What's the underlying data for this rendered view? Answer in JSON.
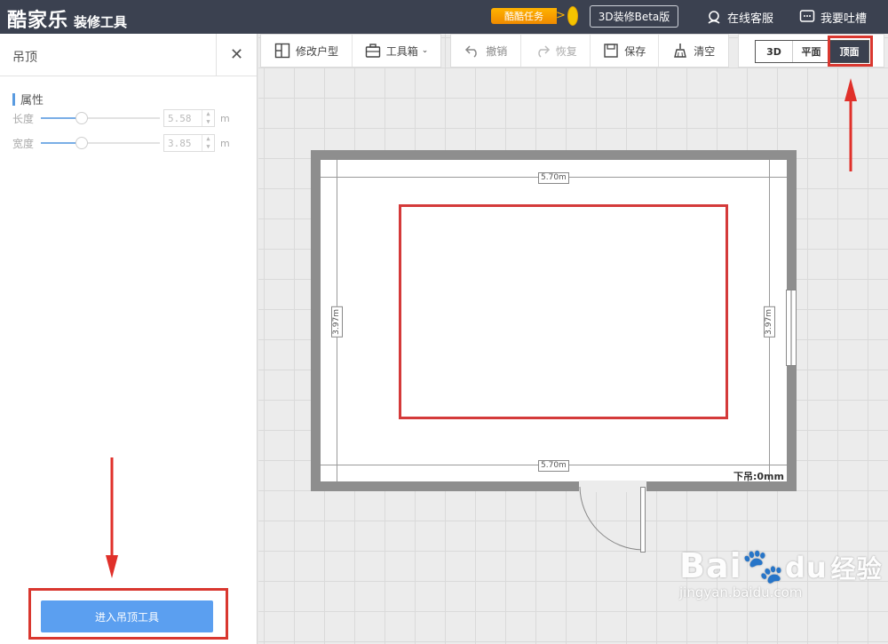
{
  "header": {
    "logo_main": "酷家乐",
    "logo_sub": "装修工具",
    "task_label": "酷酷任务",
    "beta_label": "3D装修Beta版",
    "service_label": "在线客服",
    "feedback_label": "我要吐槽"
  },
  "panel": {
    "title": "吊顶",
    "props_heading": "属性",
    "length_label": "长度",
    "length_value": "5.58",
    "width_label": "宽度",
    "width_value": "3.85",
    "unit": "m",
    "enter_button": "进入吊顶工具"
  },
  "toolbar": {
    "modify_layout": "修改户型",
    "toolbox": "工具箱",
    "undo": "撤销",
    "redo": "恢复",
    "save": "保存",
    "clear": "清空"
  },
  "views": {
    "view_3d": "3D",
    "view_plan": "平面",
    "view_ceiling": "顶面"
  },
  "plan": {
    "dim_top": "5.70m",
    "dim_bottom": "5.70m",
    "dim_left": "3.97m",
    "dim_right": "3.97m",
    "drop_label": "下吊:0mm"
  },
  "watermark": {
    "brand": "Bai",
    "brand_cn": "经验",
    "url": "jingyan.baidu.com"
  },
  "colors": {
    "header_bg": "#3b4150",
    "accent_blue": "#5b9ff0",
    "highlight_red": "#d9372f"
  }
}
